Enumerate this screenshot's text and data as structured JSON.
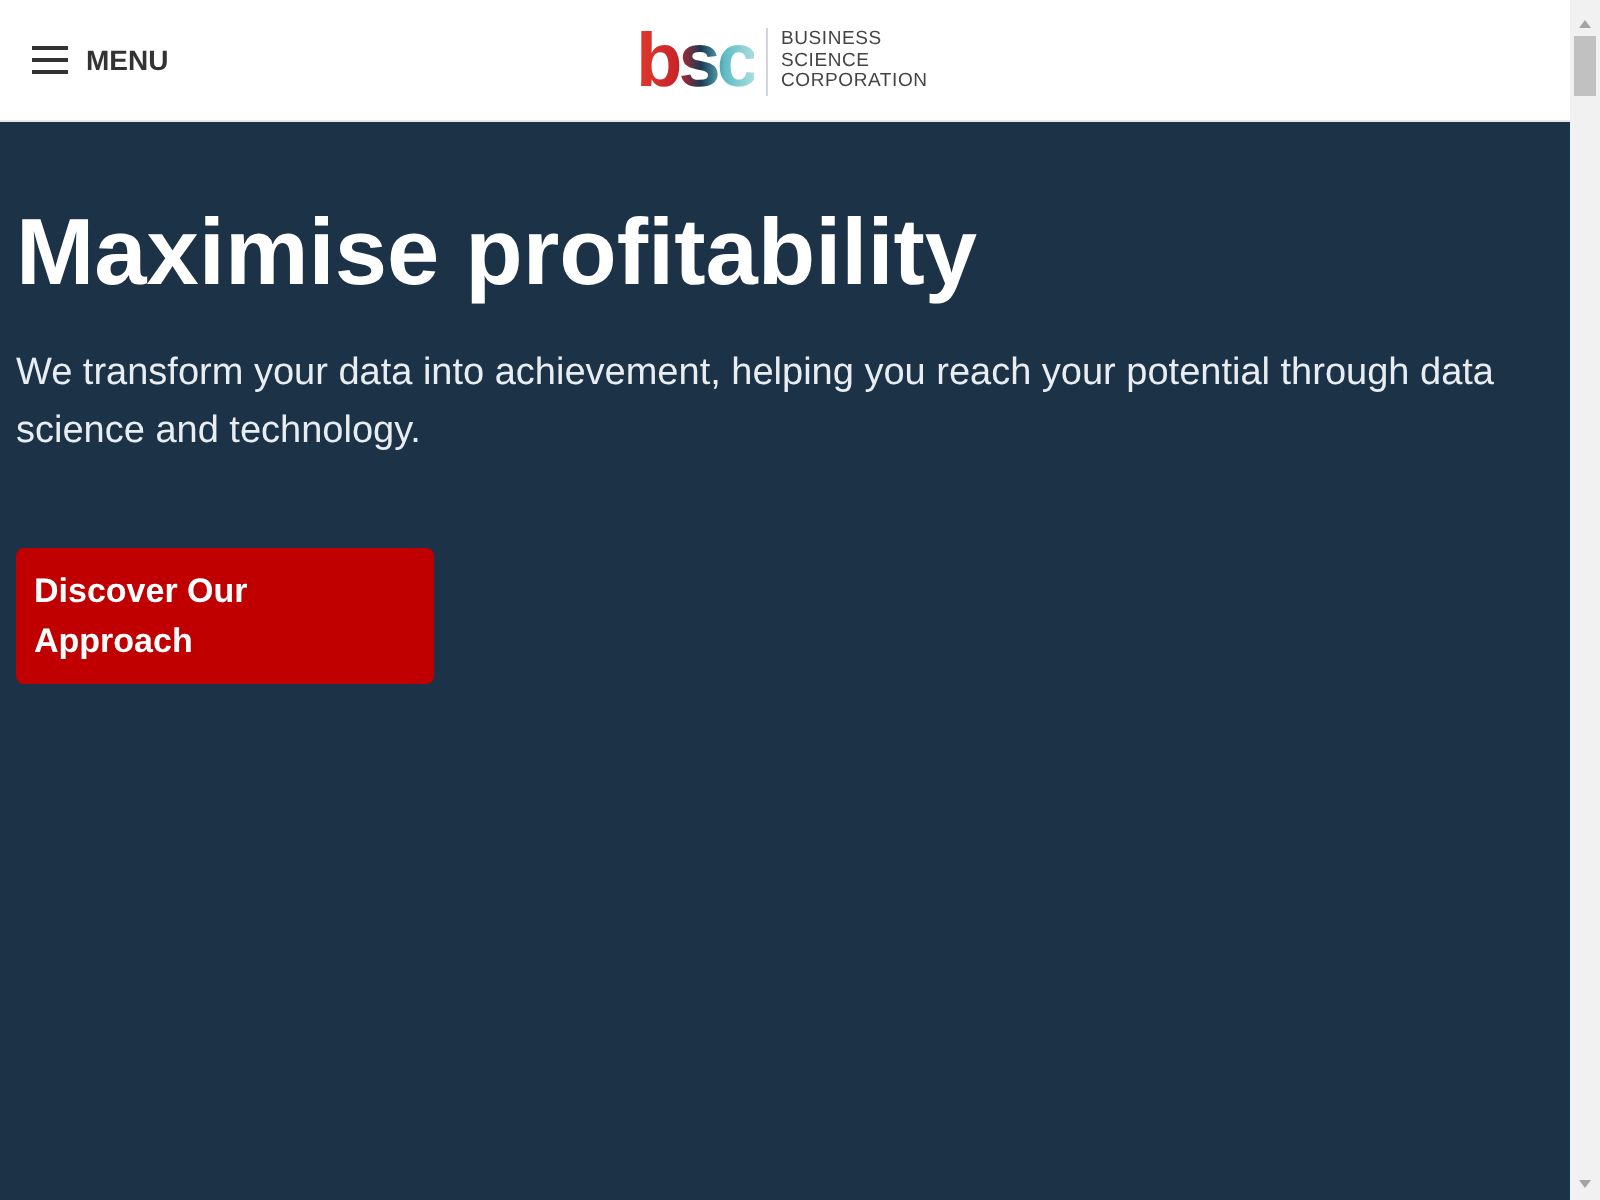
{
  "header": {
    "menu_label": "MENU",
    "logo": {
      "mark": "bsc",
      "lines": [
        "BUSINESS",
        "SCIENCE",
        "CORPORATION"
      ]
    }
  },
  "hero": {
    "headline": "Maximise profitability",
    "lead": "We transform your data into achievement, helping you reach your potential through data science and technology.",
    "cta": "Discover Our Approach"
  }
}
